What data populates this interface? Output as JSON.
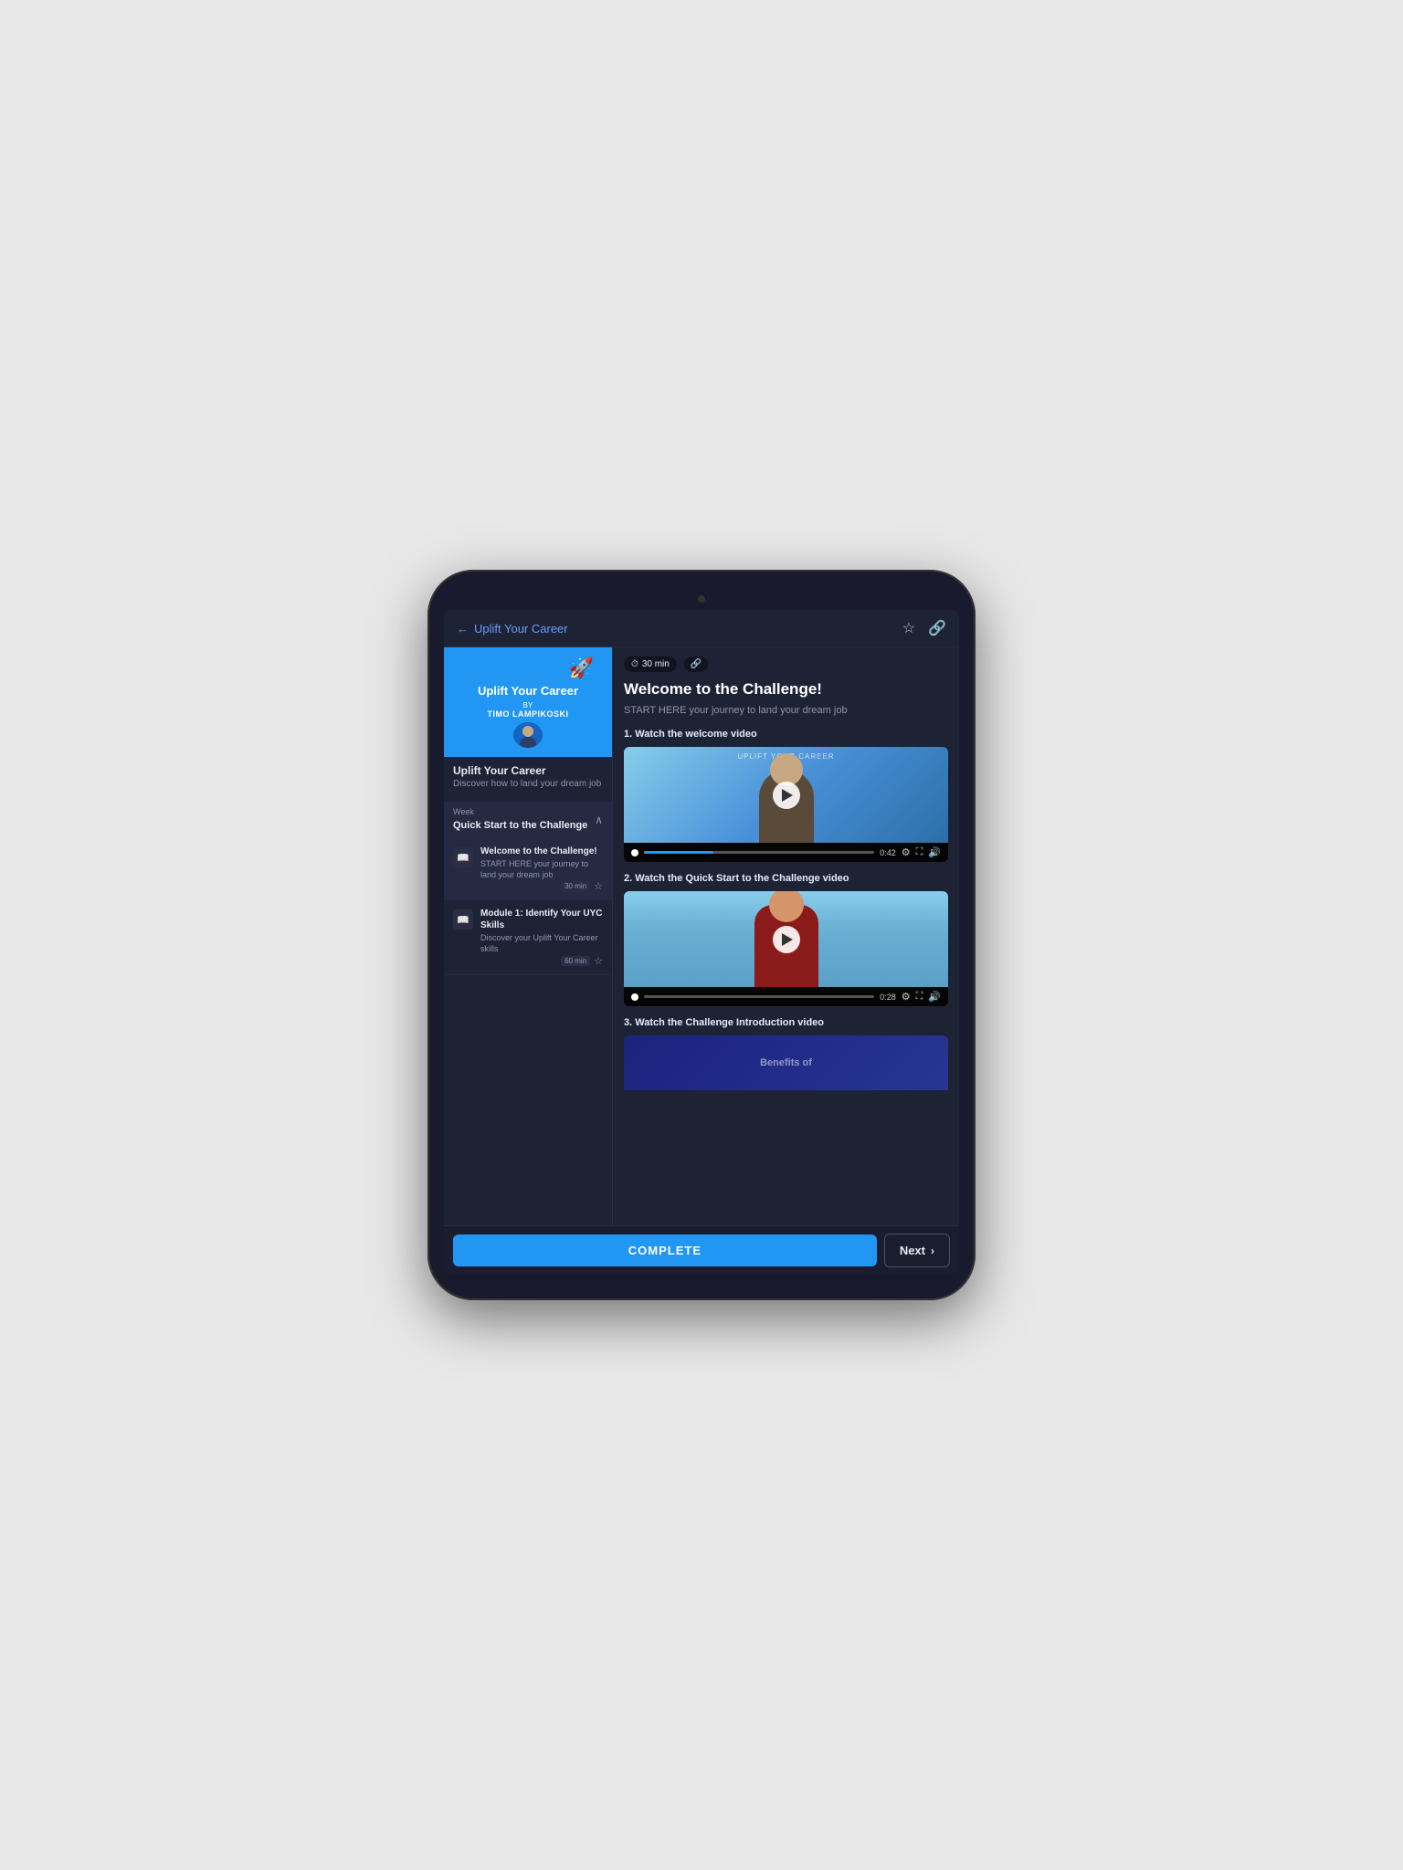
{
  "header": {
    "back_label": "Uplift Your Career",
    "back_icon": "←",
    "star_icon": "☆",
    "link_icon": "🔗"
  },
  "course": {
    "cover_rocket": "🚀",
    "title": "Uplift Your Career",
    "by_label": "BY",
    "author": "TIMO LAMPIKOSKI",
    "subtitle": "Discover how to land your dream job"
  },
  "week": {
    "label": "Week",
    "title": "Quick Start to the Challenge",
    "chevron": "∧"
  },
  "lessons": [
    {
      "name": "Welcome to the Challenge!",
      "desc": "START HERE your journey to land your dream job",
      "duration": "30 min",
      "active": true
    },
    {
      "name": "Module 1: Identify Your UYC Skills",
      "desc": "Discover your Uplift Your Career skills",
      "duration": "60 min",
      "active": false
    }
  ],
  "content": {
    "time_badge": "30 min",
    "time_icon": "⏱",
    "link_icon": "🔗",
    "title": "Welcome to the Challenge!",
    "description": "START HERE your journey to land your dream job",
    "step1_label": "1. Watch the welcome video",
    "step2_label": "2. Watch the Quick Start to the Challenge video",
    "step3_label": "3. Watch the Challenge Introduction video",
    "video1": {
      "label": "UPLIFT YOUR CAREER",
      "time": "0:42"
    },
    "video2": {
      "time": "0:28"
    },
    "video3": {
      "partial_text": "Benefits of"
    }
  },
  "footer": {
    "complete_label": "COMPLETE",
    "next_label": "Next",
    "next_arrow": "›"
  }
}
